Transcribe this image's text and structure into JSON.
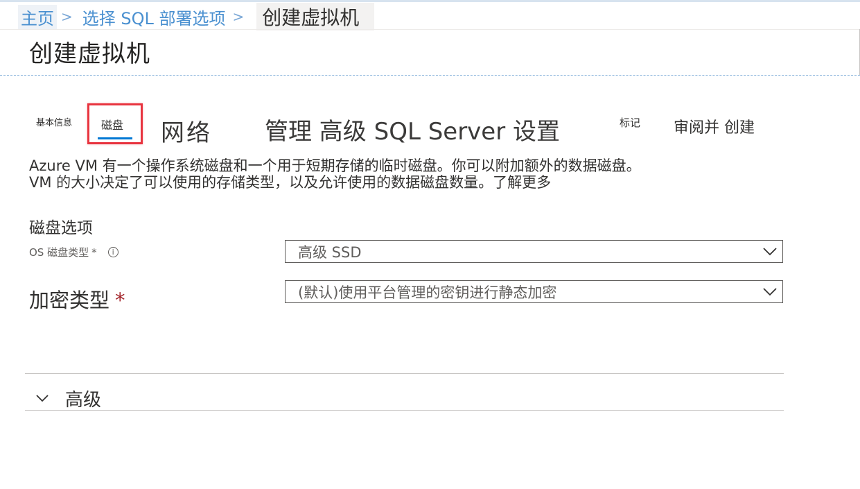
{
  "breadcrumb": {
    "home": "主页",
    "sep": ">",
    "deploy": "选择 SQL 部署选项",
    "current": "创建虚拟机"
  },
  "page": {
    "title": "创建虚拟机"
  },
  "tabs": {
    "basics": "基本信息",
    "disks": "磁盘",
    "networking": "网络",
    "management": "管理 高级 SQL Server 设置",
    "tags": "标记",
    "review": "审阅并 创建",
    "active": "磁盘"
  },
  "description": {
    "line1": "Azure VM 有一个操作系统磁盘和一个用于短期存储的临时磁盘。你可以附加额外的数据磁盘。",
    "line2": "VM 的大小决定了可以使用的存储类型，以及允许使用的数据磁盘数量。了解更多"
  },
  "disk_options": {
    "title": "磁盘选项",
    "os_disk_type": {
      "label": "OS 磁盘类型",
      "required": "*",
      "value": "高级 SSD"
    },
    "encryption_type": {
      "label": "加密类型",
      "required": "*",
      "value": "(默认)使用平台管理的密钥进行静态加密"
    }
  },
  "advanced": {
    "label": "高级"
  },
  "colors": {
    "accent": "#0078d4",
    "highlight": "#e8343f",
    "required": "#a4262c"
  },
  "icons": [
    "info-icon",
    "chevron-down-icon"
  ]
}
